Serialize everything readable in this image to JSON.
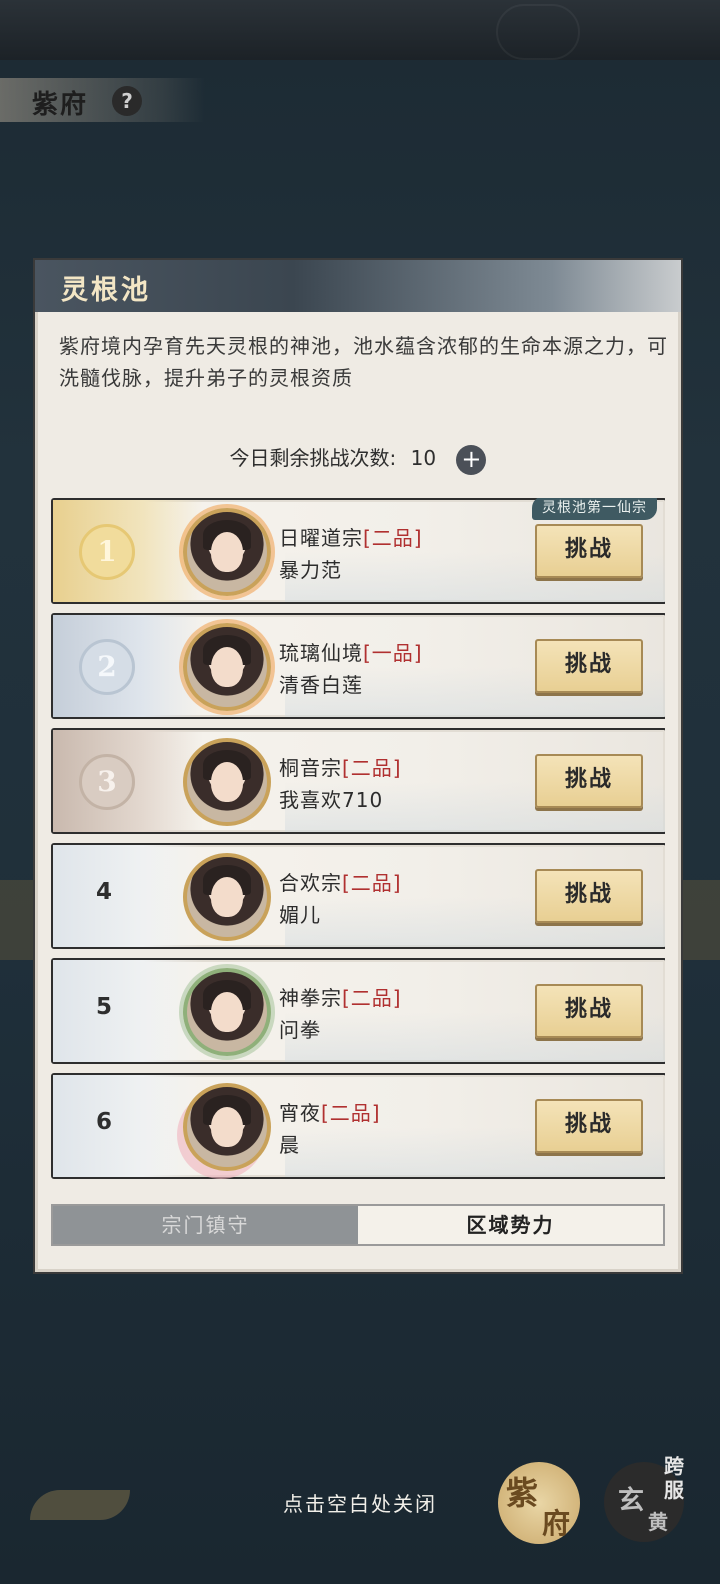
{
  "header": {
    "title": "紫府",
    "help_icon": "?"
  },
  "panel": {
    "title": "灵根池",
    "description": "紫府境内孕育先天灵根的神池，池水蕴含浓郁的生命本源之力，可洗髓伐脉，提升弟子的灵根资质",
    "attempts_label": "今日剩余挑战次数:",
    "attempts_value": "10",
    "add_icon": "+"
  },
  "ranking": [
    {
      "rank": "1",
      "sect": "日曜道宗",
      "grade": "[二品]",
      "player": "暴力范",
      "button": "挑战",
      "badge": "灵根池第一仙宗",
      "tier": "gold"
    },
    {
      "rank": "2",
      "sect": "琉璃仙境",
      "grade": "[一品]",
      "player": "清香白莲",
      "button": "挑战",
      "tier": "silver"
    },
    {
      "rank": "3",
      "sect": "桐音宗",
      "grade": "[二品]",
      "player": "我喜欢710",
      "button": "挑战",
      "tier": "bronze"
    },
    {
      "rank": "4",
      "sect": "合欢宗",
      "grade": "[二品]",
      "player": "媚儿",
      "button": "挑战",
      "tier": "plain"
    },
    {
      "rank": "5",
      "sect": "神拳宗",
      "grade": "[二品]",
      "player": "问拳",
      "button": "挑战",
      "tier": "plain"
    },
    {
      "rank": "6",
      "sect": "宵夜",
      "grade": "[二品]",
      "player": "晨",
      "button": "挑战",
      "tier": "plain"
    }
  ],
  "tabs": [
    {
      "label": "宗门镇守",
      "active": false
    },
    {
      "label": "区域势力",
      "active": true
    }
  ],
  "footer": {
    "close_hint": "点击空白处关闭",
    "realm_zi_1": "紫",
    "realm_zi_2": "府",
    "realm_xuan_1": "玄",
    "realm_xuan_2": "黄",
    "cross_server": "跨服"
  }
}
